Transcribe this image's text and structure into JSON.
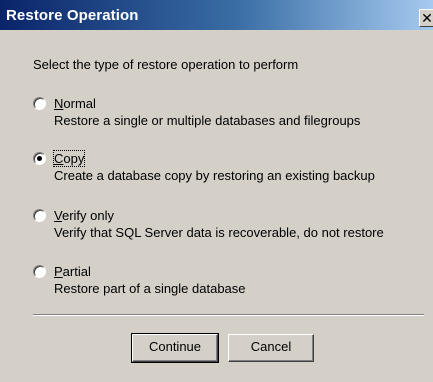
{
  "window": {
    "title": "Restore Operation",
    "close_symbol": "✕"
  },
  "dialog": {
    "prompt": "Select the type of restore operation to perform",
    "options": [
      {
        "label_first": "N",
        "label_rest": "ormal",
        "description": "Restore a single or multiple databases and filegroups",
        "selected": false
      },
      {
        "label_first": "C",
        "label_rest": "opy",
        "description": "Create a database copy by restoring an existing backup",
        "selected": true
      },
      {
        "label_first": "V",
        "label_rest": "erify only",
        "description": "Verify that SQL Server data is recoverable, do not restore",
        "selected": false
      },
      {
        "label_first": "P",
        "label_rest": "artial",
        "description": "Restore part of a single database",
        "selected": false
      }
    ],
    "buttons": {
      "continue_label": "Continue",
      "cancel_label": "Cancel"
    }
  },
  "colors": {
    "titlebar_start": "#0a246a",
    "titlebar_end": "#a6caf0",
    "face": "#d4d0c8"
  }
}
